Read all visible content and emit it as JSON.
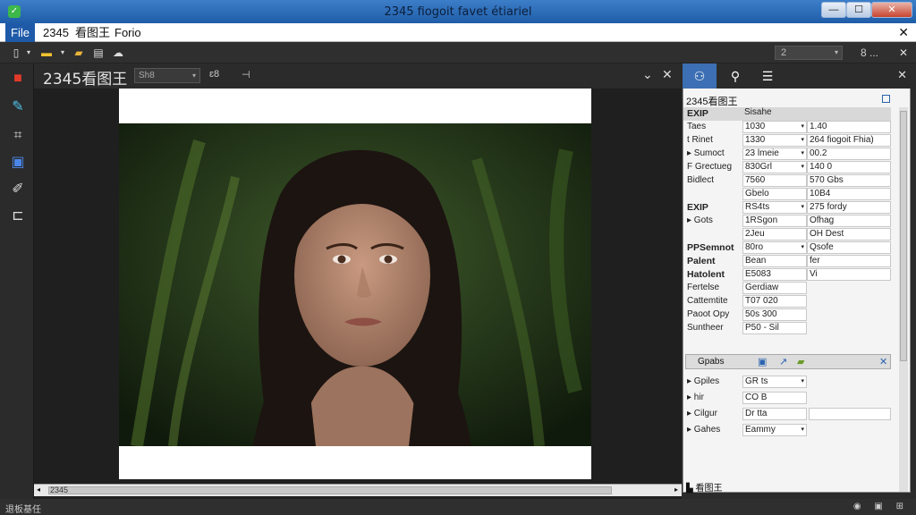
{
  "window": {
    "title": "2345 fiogoit favet étiariel",
    "buttons": {
      "minimize": "—",
      "maximize": "☐",
      "close": "✕"
    }
  },
  "menubar": {
    "items": [
      "File",
      "2345",
      "看图王",
      "Forio"
    ],
    "close_glyph": "✕"
  },
  "toolbar": {
    "zoom_value": "2",
    "right_text": "8 ...",
    "right_close": "✕"
  },
  "document": {
    "title": "2345看图王",
    "select_value": "Sh8",
    "text_a": "ɛ8",
    "text_b": "⊣",
    "close_a": "⌄",
    "close_b": "✕"
  },
  "scrollbar": {
    "label": "2345"
  },
  "panel": {
    "title": "2345看图王",
    "rows": [
      {
        "k": "EXIP",
        "v1": "Sisahe",
        "v2": "",
        "bold": true,
        "hdr": true
      },
      {
        "k": "Taes",
        "v1": "1030",
        "dd1": true,
        "v2": "1.40"
      },
      {
        "k": "t Rinet",
        "v1": "1330",
        "dd1": true,
        "v2": "264 fiogoit Fhia)"
      },
      {
        "k": "▸ Sumoct",
        "v1": "23 lmeie",
        "dd1": true,
        "v2": "00.2"
      },
      {
        "k": "F Grectueg",
        "v1": "830Grl",
        "dd1": true,
        "v2": "140 0"
      },
      {
        "k": "Bidlect",
        "v1": "7560",
        "v2": "570 Gbs"
      },
      {
        "k": "",
        "v1": "Gbelo",
        "v2": "10B4"
      },
      {
        "k": "EXIP",
        "v1": "RS4ts",
        "dd1": true,
        "v2": "275 fordy",
        "bold": true
      },
      {
        "k": "▸ Gots",
        "v1": "1RSgon",
        "v2": "Ofhag"
      },
      {
        "k": "",
        "v1": "2Jeu",
        "v2": "OH Dest"
      },
      {
        "k": "PPSemnot",
        "v1": "80ro",
        "dd1": true,
        "v2": "Qsofe",
        "bold": true
      },
      {
        "k": "Palent",
        "v1": "Bean",
        "v2": "fer",
        "bold": true
      },
      {
        "k": "Hatolent",
        "v1": "E5083",
        "v2": "Vi",
        "bold": true
      },
      {
        "k": "Fertelse",
        "v1": "Gerdiaw",
        "v2": ""
      },
      {
        "k": "Cattemtite",
        "v1": "T07 020",
        "v2": ""
      },
      {
        "k": "Paoot Opy",
        "v1": "50s 300",
        "v2": ""
      },
      {
        "k": "Suntheer",
        "v1": "P50 - Sil",
        "v2": ""
      }
    ],
    "section_label": "Gpabs",
    "section_close": "✕",
    "rows2": [
      {
        "k": "▸ Gpiles",
        "v1": "GR ts",
        "dd1": true
      },
      {
        "k": "▸ hir",
        "v1": "CO B"
      },
      {
        "k": "▸ Cilgur",
        "v1": "Dr tta",
        "extra": true
      },
      {
        "k": "▸ Gahes",
        "v1": "Eammy",
        "dd1": true
      }
    ],
    "footer": "看图王"
  },
  "status": {
    "left": "退板基任",
    "right": "◉ ▣ ⊞"
  },
  "colors": {
    "titlebar": "#2a6ab8",
    "accent": "#3c6fb3",
    "menu_active": "#1e5aa8"
  },
  "icons": {
    "left_tools": [
      "select-tool-icon",
      "edit-tool-icon",
      "crop-tool-icon",
      "frame-tool-icon",
      "brush-tool-icon",
      "layout-tool-icon"
    ],
    "panel_tabs": [
      "users-icon",
      "search-icon",
      "list-icon"
    ]
  }
}
